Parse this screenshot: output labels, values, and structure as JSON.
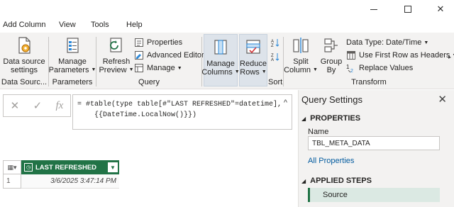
{
  "window": {
    "minimize_glyph": "—",
    "maximize_glyph": "☐",
    "close_glyph": "✕"
  },
  "menu": {
    "tabs": [
      "Add Column",
      "View",
      "Tools",
      "Help"
    ]
  },
  "ribbon": {
    "data_sources": {
      "button_label_1": "Data source",
      "button_label_2": "settings",
      "group_label": "Data Sourc..."
    },
    "parameters": {
      "button_label_1": "Manage",
      "button_label_2": "Parameters",
      "group_label": "Parameters"
    },
    "query": {
      "refresh_label_1": "Refresh",
      "refresh_label_2": "Preview",
      "properties_label": "Properties",
      "advanced_editor_label": "Advanced Editor",
      "manage_label": "Manage",
      "group_label": "Query"
    },
    "manage_columns": {
      "label_1": "Manage",
      "label_2": "Columns"
    },
    "reduce_rows": {
      "label_1": "Reduce",
      "label_2": "Rows"
    },
    "sort": {
      "group_label": "Sort"
    },
    "transform": {
      "split_column_1": "Split",
      "split_column_2": "Column",
      "group_by_1": "Group",
      "group_by_2": "By",
      "data_type_label": "Data Type: Date/Time",
      "use_first_row_label": "Use First Row as Headers",
      "replace_values_label": "Replace Values",
      "group_label": "Transform"
    },
    "accent_color": "#217346"
  },
  "formula_bar": {
    "cancel_glyph": "✕",
    "confirm_glyph": "✓",
    "fx_glyph": "fx",
    "line1": "= #table(type table[#\"LAST REFRESHED\"=datetime],",
    "line2": "    {{DateTime.LocalNow()}})",
    "expand_glyph": "^"
  },
  "grid": {
    "column_header": "LAST REFRESHED",
    "rows": [
      {
        "num": "1",
        "value": "3/6/2025 3:47:14 PM"
      }
    ]
  },
  "query_settings": {
    "title": "Query Settings",
    "properties_heading": "PROPERTIES",
    "name_label": "Name",
    "name_value": "TBL_META_DATA",
    "all_properties_link": "All Properties",
    "applied_steps_heading": "APPLIED STEPS",
    "steps": [
      "Source"
    ]
  }
}
